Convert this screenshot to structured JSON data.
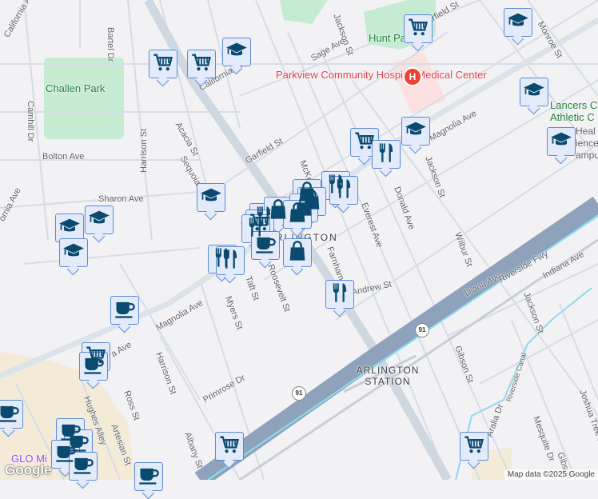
{
  "map": {
    "places": {
      "challen_park": "Challen Park",
      "hunt_park": "Hunt Park",
      "hospital": "Parkview Community Hospital Medical Center",
      "hospital_badge": "H",
      "lancers": "Lancers C Athletic C",
      "health": "Heal ience ampu",
      "arlington": "ARLINGTON",
      "station": "ARLINGTON STATION",
      "glo": "GLO Mi"
    },
    "streets": {
      "bartel": "Bartel Dr",
      "california1": "California Ave",
      "california2": "California Ave",
      "camhill": "Camhill Dr",
      "bolton": "Bolton Ave",
      "ornia": "ornia Ave",
      "sharon": "Sharon Ave",
      "harrison1": "Harrison St",
      "acacia": "Acacia St",
      "sequoia": "Sequoia St",
      "garfield1": "Garfield St",
      "garfield2": "Garfield St",
      "sage": "Sage Ave",
      "jackson1": "Jackson St",
      "jackson2": "Jackson St",
      "jackson3": "Jackson St",
      "magnolia1": "Magnolia Ave",
      "magnolia2": "Magnolia Ave",
      "magnolia3": "a Ave",
      "monroe": "Monroe St",
      "mckenzie": "McKenzie St",
      "donald": "Donald Ave",
      "everest": "Everest Ave",
      "wilbur": "Wilbur St",
      "diana": "Diana Ave",
      "riverside_fwy": "Riverside Fwy",
      "indiana": "Indiana Ave",
      "farnham": "Farnham Pl",
      "andrew": "Andrew St",
      "roosevelt": "Roosevelt St",
      "taft": "Taft St",
      "myers": "Myers St",
      "harrison2": "Harrison St",
      "ross": "Ross St",
      "hughes": "Hughes Alley",
      "artesian": "Artesian St",
      "primrose": "Primrose Dr",
      "albany": "Albany St",
      "gibson1": "Gibson St",
      "gibson2": "Gibson",
      "canal": "Riverside Canal",
      "aralia": "Aralia Dr",
      "mesquite": "Mesquite Dr",
      "joshua": "Joshua Tree Rd"
    },
    "route_shields": [
      "91",
      "91"
    ],
    "attribution": "Map data ©2025 Google",
    "logo": "Google",
    "marker_types": {
      "cart": "shopping-cart-icon",
      "school": "graduation-cap-icon",
      "food": "restaurant-icon",
      "shop": "shopping-bag-icon",
      "coffee": "coffee-cup-icon"
    },
    "colors": {
      "marker_fill": "#e3ebfb",
      "marker_border": "#5b8ad6",
      "icon": "#0b4a6f",
      "park": "#c5ecd3",
      "freeway": "#8ea3bb"
    }
  }
}
